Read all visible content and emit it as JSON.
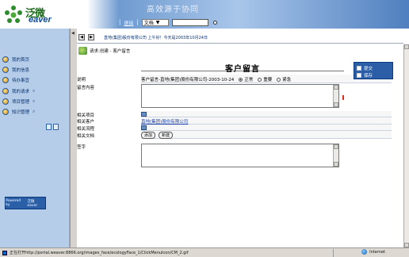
{
  "header": {
    "logo_text": "泛微",
    "logo_sub": "eaver",
    "banner": "高效源于协同",
    "exit_label": "退出",
    "doc_select": "文档",
    "search_value": ""
  },
  "sidebar": {
    "items": [
      {
        "label": "我的首页"
      },
      {
        "label": "我的信息"
      },
      {
        "label": "待办事宜"
      },
      {
        "label": "我的请求"
      },
      {
        "label": "项目管理"
      },
      {
        "label": "知识管理"
      }
    ],
    "powered_text": "Powered by",
    "powered_logo": "泛微 eaver"
  },
  "nav": {
    "welcome": "直地(集团)股份有限公司 上午好！今天是2003年10月24日"
  },
  "page_head": {
    "title": "请求:创建 - 客户留言"
  },
  "form": {
    "title": "客户留言",
    "labels": {
      "subject": "说明",
      "content": "留言内容",
      "related_project": "相关项目",
      "related_customer": "相关客户",
      "related_workflow": "相关流程",
      "related_doc": "相关文档",
      "signature": "签字"
    },
    "subject_value": "客户留言-直地(集团)股份有限公司-2003-10-24",
    "priority": {
      "options": [
        "正常",
        "重要",
        "紧急"
      ],
      "selected": "正常"
    },
    "customer_value": "直地(集团)股份有限公司",
    "doc_buttons": [
      "添加",
      "新建"
    ]
  },
  "right_menu": {
    "items": [
      {
        "label": "提交"
      },
      {
        "label": "保存"
      }
    ]
  },
  "statusbar": {
    "text": "正在打开http://portal.weaver.8866.org/images_face/ecologyFace_1/ClickMenuIcon/CM_2.gif",
    "zone": "Internet"
  },
  "colors": {
    "sidebar_bg": "#b6cdea",
    "menu_bg": "#2b5ea6",
    "link": "#1a3fa8",
    "alert_red": "#e0301c"
  }
}
